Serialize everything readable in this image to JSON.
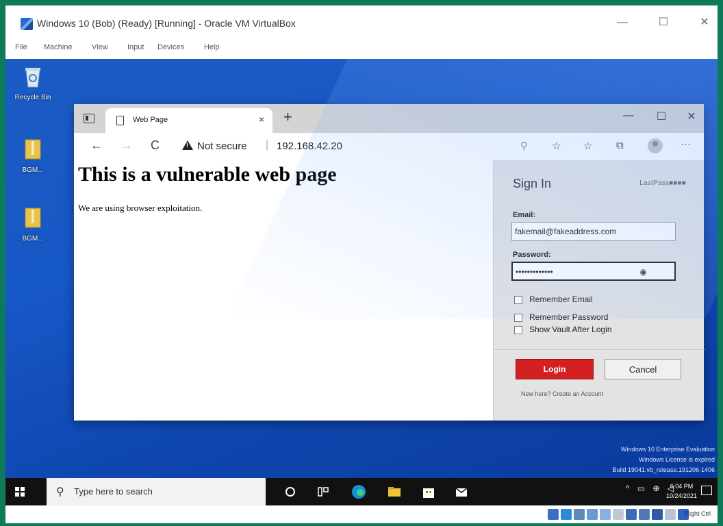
{
  "vbox": {
    "title": "Windows 10 (Bob) (Ready) [Running] - Oracle VM VirtualBox",
    "menu": [
      "File",
      "Machine",
      "View",
      "Input",
      "Devices",
      "Help"
    ],
    "minimize": "—",
    "maximize": "☐",
    "close": "✕",
    "host_key": "Right Ctrl"
  },
  "desktop": {
    "icons": [
      {
        "label": "Recycle Bin"
      },
      {
        "label": "BGM..."
      },
      {
        "label": "BGM..."
      }
    ],
    "watermark": [
      "Windows 10 Enterprise Evaluation",
      "Windows License is expired",
      "Build 19041.vb_release.191206-1406"
    ]
  },
  "browser": {
    "tab_title": "Web Page",
    "tab_close": "×",
    "new_tab": "+",
    "minimize": "—",
    "maximize": "☐",
    "close": "✕",
    "back": "←",
    "forward": "→",
    "refresh": "C",
    "not_secure": "Not secure",
    "separator": "|",
    "url": "192.168.42.20",
    "menu": "···"
  },
  "page": {
    "heading": "This is a vulnerable web page",
    "text": "We are using browser exploitation."
  },
  "lastpass": {
    "title": "Sign In",
    "brand": "LastPass■■■■",
    "email_label": "Email:",
    "email_value": "fakemail@fakeaddress.com",
    "password_label": "Password:",
    "password_value": "•••••••••••••",
    "remember_email": "Remember Email",
    "remember_password": "Remember Password",
    "show_vault": "Show Vault After Login",
    "login": "Login",
    "cancel": "Cancel",
    "create_account": "New here? Create an Account"
  },
  "taskbar": {
    "search_placeholder": "Type here to search",
    "time": "6:04 PM",
    "date": "10/24/2021"
  }
}
